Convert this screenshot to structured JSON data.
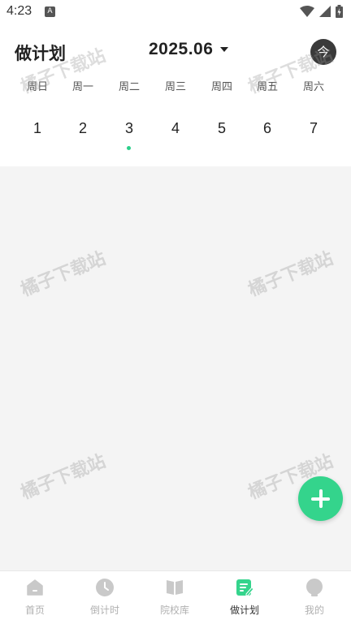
{
  "status_bar": {
    "time": "4:23",
    "app_indicator": "A",
    "icons": [
      "wifi-icon",
      "signal-icon",
      "battery-icon"
    ]
  },
  "header": {
    "title": "做计划",
    "month": "2025.06",
    "today_button": "今"
  },
  "calendar": {
    "weekdays": [
      "周日",
      "周一",
      "周二",
      "周三",
      "周四",
      "周五",
      "周六"
    ],
    "dates": [
      "1",
      "2",
      "3",
      "4",
      "5",
      "6",
      "7"
    ],
    "marked_date": "3"
  },
  "watermark": "橘子下载站",
  "fab": {
    "icon": "plus-icon"
  },
  "bottom_nav": {
    "items": [
      {
        "label": "首页",
        "icon": "home-icon"
      },
      {
        "label": "倒计时",
        "icon": "clock-icon"
      },
      {
        "label": "院校库",
        "icon": "book-icon"
      },
      {
        "label": "做计划",
        "icon": "edit-note-icon"
      },
      {
        "label": "我的",
        "icon": "profile-icon"
      }
    ],
    "active": "做计划"
  },
  "colors": {
    "accent": "#34d48c",
    "inactive": "#b0b0b0",
    "background": "#f4f4f4"
  }
}
